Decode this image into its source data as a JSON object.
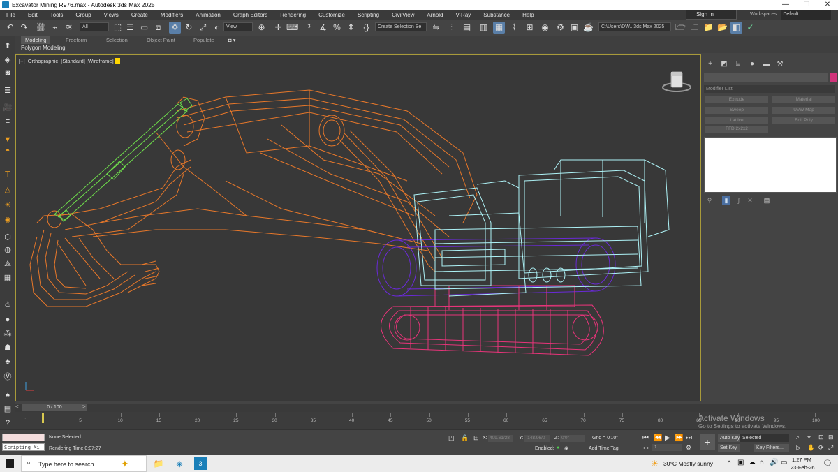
{
  "titlebar": {
    "title": "Excavator Mining R976.max - Autodesk 3ds Max 2025",
    "minimize_glyph": "—",
    "maximize_glyph": "❐",
    "close_glyph": "✕"
  },
  "menu": [
    "File",
    "Edit",
    "Tools",
    "Group",
    "Views",
    "Create",
    "Modifiers",
    "Animation",
    "Graph Editors",
    "Rendering",
    "Customize",
    "Scripting",
    "CivilView",
    "Arnold",
    "V-Ray",
    "Substance",
    "Help"
  ],
  "signin": "Sign In",
  "workspaces": {
    "label": "Workspaces:",
    "value": "Default"
  },
  "toolbar": {
    "filter": "All",
    "refcoord": "View",
    "selection_set": "Create Selection Se",
    "project_path": "C:\\Users\\DW...3ds Max 2025"
  },
  "ribbon": {
    "tabs": [
      "Modeling",
      "Freeform",
      "Selection",
      "Object Paint",
      "Populate"
    ],
    "active_tab": "Modeling",
    "subtitle": "Polygon Modeling"
  },
  "viewport": {
    "label": "[+] [Orthographic] [Standard] [Wireframe]"
  },
  "command_panel": {
    "modifier_list": "Modifier List",
    "buttons": [
      "Extrude",
      "Material",
      "Sweep",
      "UVW Map",
      "Lattice",
      "Edit Poly",
      "FFD 2x2x2"
    ]
  },
  "timeline": {
    "frame_display": "0 / 100",
    "ticks": [
      "5",
      "10",
      "15",
      "20",
      "25",
      "30",
      "35",
      "40",
      "45",
      "50",
      "55",
      "60",
      "65",
      "70",
      "75",
      "80",
      "85",
      "90",
      "95",
      "100"
    ]
  },
  "status": {
    "selection": "None Selected",
    "render_time": "Rendering Time  0:07:27",
    "script_mini": "Scripting Mi",
    "x_label": "X:",
    "x_value": "409.61/28",
    "y_label": "Y:",
    "y_value": "-148.96/0",
    "z_label": "Z:",
    "z_value": "0'0\"",
    "grid": "Grid = 0'10\"",
    "enabled": "Enabled:",
    "add_time_tag": "Add Time Tag",
    "auto_key": "Auto Key",
    "set_key": "Set Key",
    "selected": "Selected",
    "key_filters": "Key Filters...",
    "frame": "0"
  },
  "activate_windows": {
    "title": "Activate Windows",
    "subtitle": "Go to Settings to activate Windows."
  },
  "taskbar": {
    "search_placeholder": "Type here to search",
    "weather": "30°C  Mostly sunny",
    "time": "1:27 PM",
    "date": "23-Feb-26"
  },
  "colors": {
    "excavator_arm": "#e8782a",
    "bucket_cylinder": "#6fe04c",
    "cab": "#aef3f7",
    "tracks": "#e8347a",
    "wheels": "#6a2ad8"
  }
}
